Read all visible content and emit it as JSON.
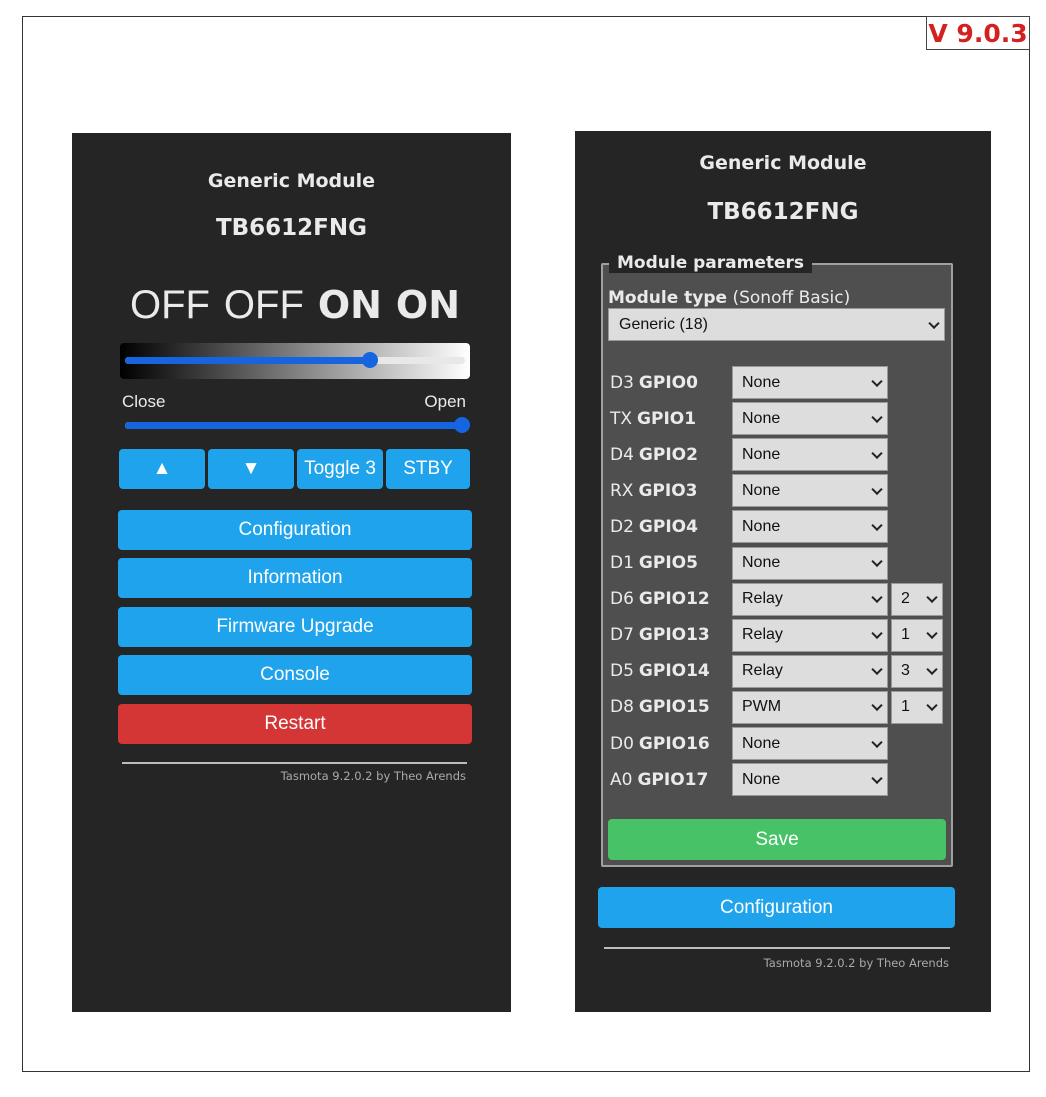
{
  "version_label": "V 9.0.3",
  "left": {
    "title": "Generic Module",
    "subtitle": "TB6612FNG",
    "states": [
      "OFF",
      "OFF",
      "ON",
      "ON"
    ],
    "slider_left_label": "Close",
    "slider_right_label": "Open",
    "dimmer_level": 0.72,
    "shutter_level": 0.99,
    "control_buttons": [
      "▲",
      "▼",
      "Toggle 3",
      "STBY"
    ],
    "menu": [
      "Configuration",
      "Information",
      "Firmware Upgrade",
      "Console"
    ],
    "restart_label": "Restart",
    "footer": "Tasmota 9.2.0.2 by Theo Arends"
  },
  "right": {
    "title": "Generic Module",
    "subtitle": "TB6612FNG",
    "legend": "Module parameters",
    "module_type_label": "Module type",
    "module_type_hint": "(Sonoff Basic)",
    "module_type_value": "Generic (18)",
    "gpios": [
      {
        "prefix": "D3",
        "name": "GPIO0",
        "func": "None",
        "idx": ""
      },
      {
        "prefix": "TX",
        "name": "GPIO1",
        "func": "None",
        "idx": ""
      },
      {
        "prefix": "D4",
        "name": "GPIO2",
        "func": "None",
        "idx": ""
      },
      {
        "prefix": "RX",
        "name": "GPIO3",
        "func": "None",
        "idx": ""
      },
      {
        "prefix": "D2",
        "name": "GPIO4",
        "func": "None",
        "idx": ""
      },
      {
        "prefix": "D1",
        "name": "GPIO5",
        "func": "None",
        "idx": ""
      },
      {
        "prefix": "D6",
        "name": "GPIO12",
        "func": "Relay",
        "idx": "2"
      },
      {
        "prefix": "D7",
        "name": "GPIO13",
        "func": "Relay",
        "idx": "1"
      },
      {
        "prefix": "D5",
        "name": "GPIO14",
        "func": "Relay",
        "idx": "3"
      },
      {
        "prefix": "D8",
        "name": "GPIO15",
        "func": "PWM",
        "idx": "1"
      },
      {
        "prefix": "D0",
        "name": "GPIO16",
        "func": "None",
        "idx": ""
      },
      {
        "prefix": "A0",
        "name": "GPIO17",
        "func": "None",
        "idx": ""
      }
    ],
    "save_label": "Save",
    "config_label": "Configuration",
    "footer": "Tasmota 9.2.0.2 by Theo Arends"
  },
  "colors": {
    "button": "#1fa3ec",
    "restart": "#d43535",
    "save": "#47c266",
    "panel": "#252525",
    "version": "#d42020"
  }
}
